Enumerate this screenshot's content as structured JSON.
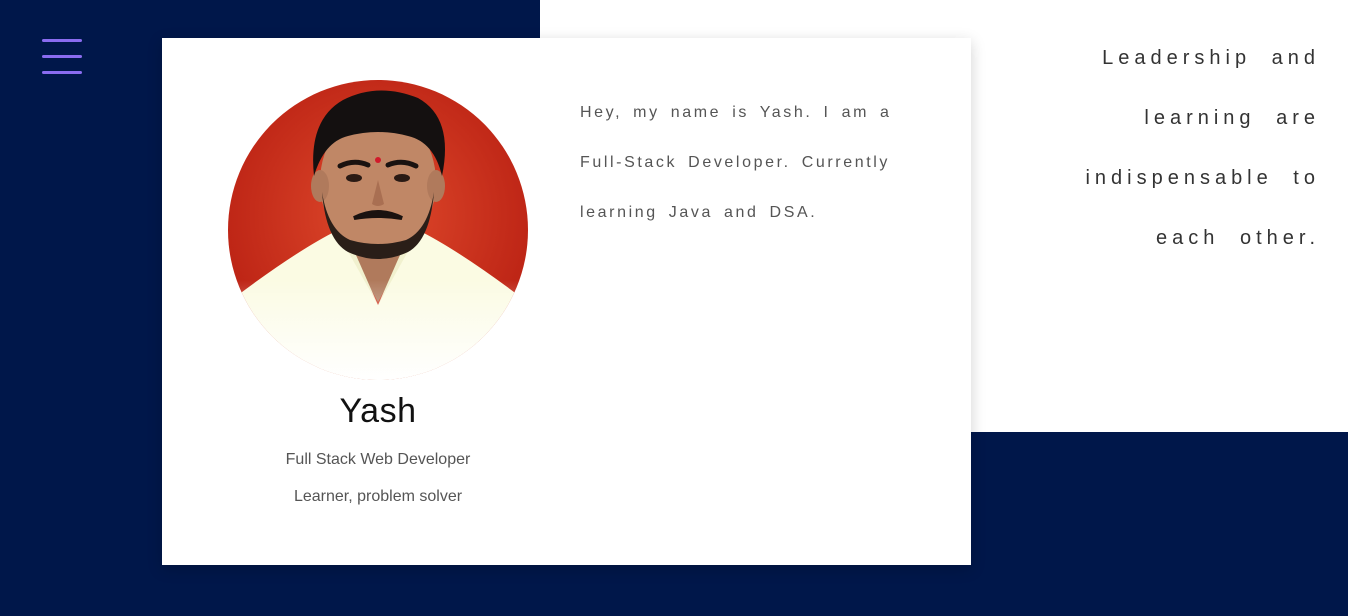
{
  "nav": {
    "menu_icon": "hamburger-menu-icon",
    "accent": "#8a6cf0"
  },
  "theme": {
    "background": "#00174a",
    "panel": "#ffffff"
  },
  "profile": {
    "photo": "profile-photo",
    "name": "Yash",
    "role": "Full Stack Web Developer",
    "tagline": "Learner, problem solver"
  },
  "bio": "Hey, my name is Yash. I am a Full-Stack Developer. Currently learning Java and DSA.",
  "quote": "Leadership and learning are indispensable to each other."
}
